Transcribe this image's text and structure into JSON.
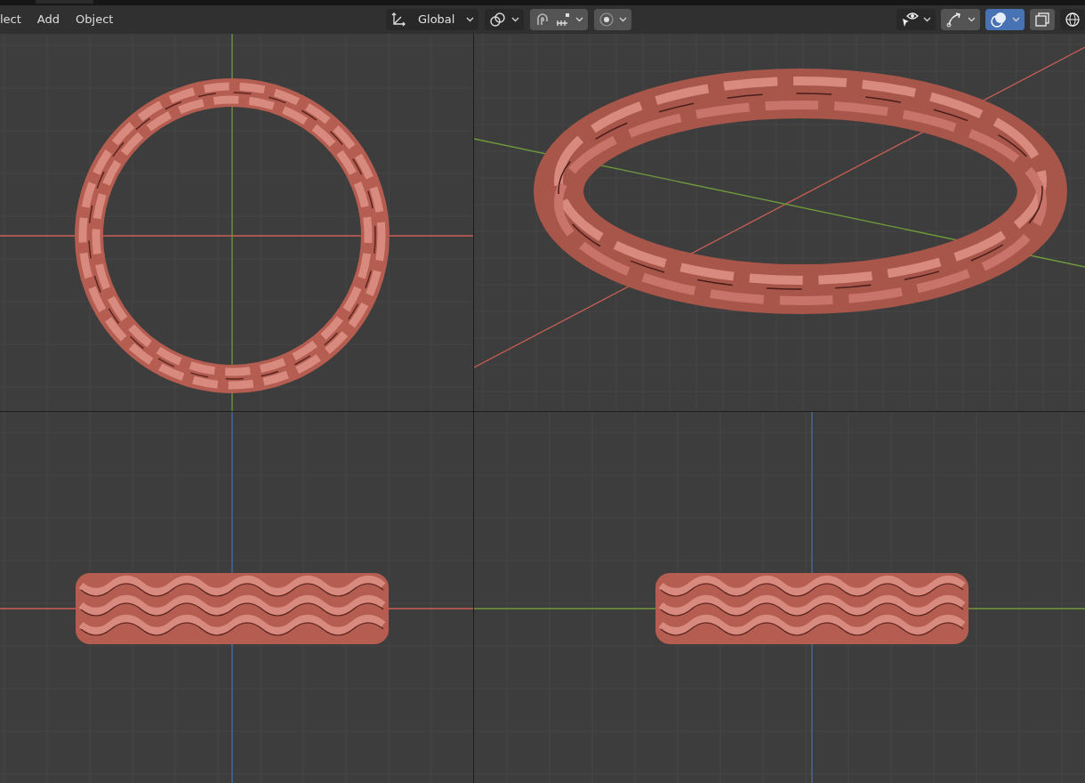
{
  "menu": [
    {
      "label": "lect"
    },
    {
      "label": "Add"
    },
    {
      "label": "Object"
    }
  ],
  "header_tools": [
    {
      "kind": "orientation",
      "label": "Global"
    },
    {
      "kind": "pivot"
    },
    {
      "kind": "snap",
      "on": false
    },
    {
      "kind": "proportional",
      "on": false
    }
  ],
  "header_right": [
    {
      "kind": "visibility"
    },
    {
      "kind": "gizmo",
      "on": false
    },
    {
      "kind": "overlay",
      "on": true
    },
    {
      "kind": "xray",
      "on": false
    },
    {
      "kind": "shading"
    }
  ],
  "viewports": [
    {
      "kind": "top"
    },
    {
      "kind": "perspective"
    },
    {
      "kind": "front"
    },
    {
      "kind": "side"
    }
  ]
}
